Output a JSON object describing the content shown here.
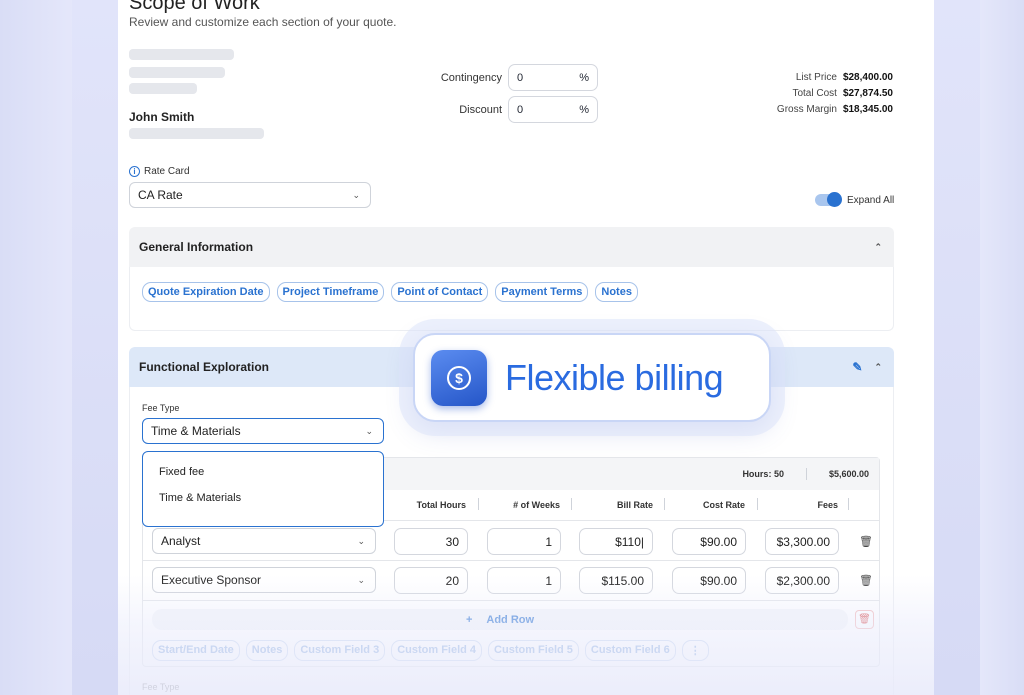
{
  "header": {
    "title": "Scope of Work",
    "subtitle": "Review and customize each section of your quote."
  },
  "customer": {
    "name": "John Smith"
  },
  "adjustments": [
    {
      "label": "Contingency",
      "value": "0",
      "unit": "%"
    },
    {
      "label": "Discount",
      "value": "0",
      "unit": "%"
    }
  ],
  "pricing": [
    {
      "label": "List Price",
      "value": "$28,400.00"
    },
    {
      "label": "Total Cost",
      "value": "$27,874.50"
    },
    {
      "label": "Gross Margin",
      "value": "$18,345.00"
    }
  ],
  "rate_card": {
    "label": "Rate Card",
    "value": "CA Rate"
  },
  "expand_all": {
    "label": "Expand All",
    "on": true
  },
  "general_info": {
    "title": "General Information",
    "chips": [
      "Quote Expiration Date",
      "Project Timeframe",
      "Point of Contact",
      "Payment Terms",
      "Notes"
    ]
  },
  "functional": {
    "title": "Functional Exploration",
    "fee_type_label": "Fee Type",
    "fee_type_value": "Time & Materials",
    "fee_options": [
      "Fixed fee",
      "Time & Materials"
    ],
    "summary_hours": "Hours: 50",
    "summary_fees": "$5,600.00",
    "columns": [
      "Total Hours",
      "# of Weeks",
      "Bill Rate",
      "Cost Rate",
      "Fees"
    ],
    "rows": [
      {
        "role": "Analyst",
        "hours": "30",
        "weeks": "1",
        "bill_rate": "$110|",
        "cost_rate": "$90.00",
        "fees": "$3,300.00"
      },
      {
        "role": "Executive Sponsor",
        "hours": "20",
        "weeks": "1",
        "bill_rate": "$115.00",
        "cost_rate": "$90.00",
        "fees": "$2,300.00"
      }
    ],
    "add_row_label": "Add Row",
    "chips": [
      "Start/End Date",
      "Notes",
      "Custom Field 3",
      "Custom Field 4",
      "Custom Field 5",
      "Custom Field 6"
    ]
  },
  "next_section": {
    "fee_type_label": "Fee Type"
  },
  "overlay": {
    "text": "Flexible billing",
    "icon": "dollar-coin-icon"
  },
  "colors": {
    "accent": "#2a72d0",
    "section_active": "#dde8f8",
    "section_gray": "#f1f2f4"
  }
}
